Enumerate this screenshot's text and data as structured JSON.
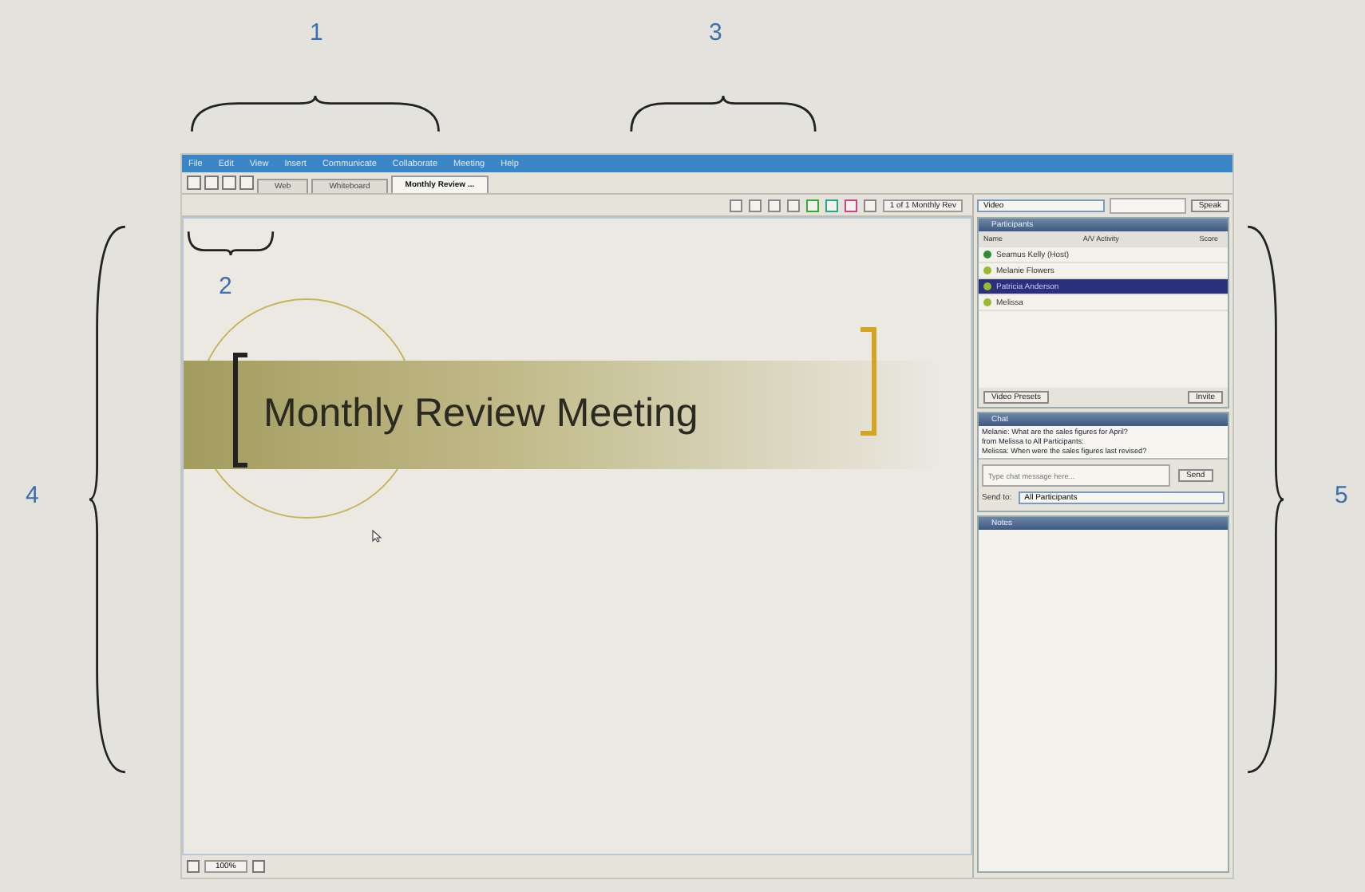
{
  "callouts": [
    {
      "label": "1",
      "kind": "horizontal"
    },
    {
      "label": "3",
      "kind": "horizontal"
    },
    {
      "label": "2",
      "kind": "horizontal"
    },
    {
      "label": "4",
      "kind": "left"
    },
    {
      "label": "5",
      "kind": "right"
    }
  ],
  "menu": [
    "File",
    "Edit",
    "View",
    "Insert",
    "Communicate",
    "Collaborate",
    "Meeting",
    "Help"
  ],
  "document_tabs": [
    {
      "label": "Web",
      "selected": false
    },
    {
      "label": "Whiteboard",
      "selected": false
    },
    {
      "label": "Monthly Review ...",
      "selected": true
    }
  ],
  "page_selector": "1 of 1 Monthly Rev",
  "slide": {
    "title": "Monthly Review Meeting"
  },
  "status_bar": {
    "zoom": "100%"
  },
  "video_select": "Video",
  "speak_button": "Speak",
  "participants": {
    "title": "Participants",
    "columns": [
      "Name",
      "A/V Activity",
      "Score"
    ],
    "rows": [
      {
        "name": "Seamus Kelly (Host)",
        "selected": false,
        "color": "#2f8a3a"
      },
      {
        "name": "Melanie Flowers",
        "selected": false,
        "color": "#9ab830"
      },
      {
        "name": "Patricia Anderson",
        "selected": true,
        "color": "#9ab830"
      },
      {
        "name": "Melissa",
        "selected": false,
        "color": "#9ab830"
      }
    ],
    "buttons": [
      "Video Presets",
      "Invite"
    ]
  },
  "chat": {
    "title": "Chat",
    "messages": [
      "Melanie: What are the sales figures for April?",
      "from Melissa to All Participants:",
      "Melissa: When were the sales figures last revised?"
    ],
    "placeholder": "Type chat message here...",
    "send_button": "Send",
    "send_to_label": "Send to:",
    "send_to": "All Participants"
  },
  "notes": {
    "title": "Notes"
  }
}
